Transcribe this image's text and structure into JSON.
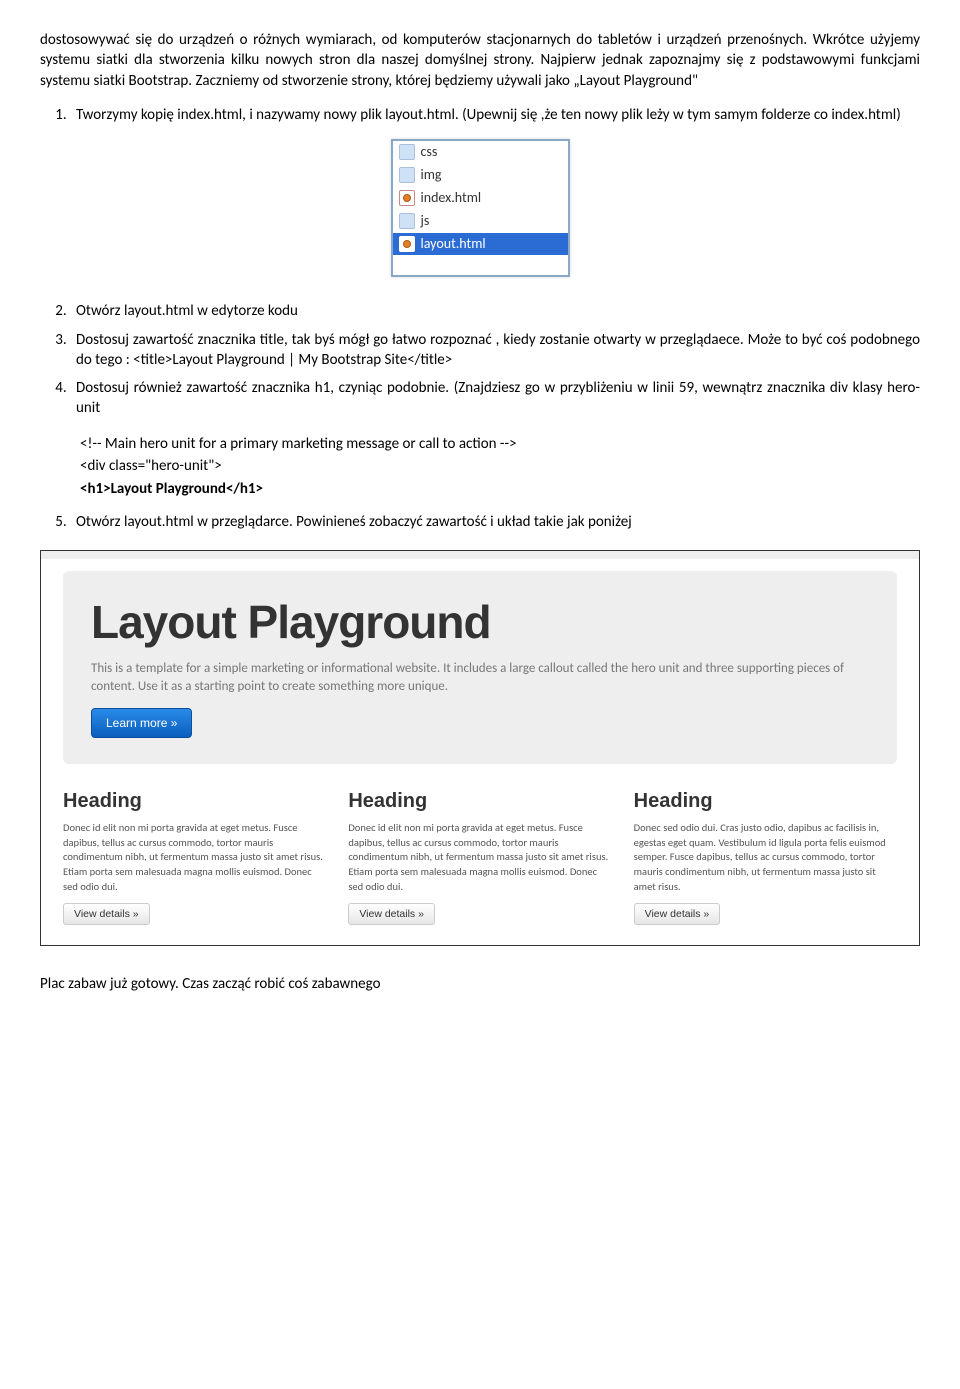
{
  "intro": "dostosowywać się do urządzeń o różnych wymiarach, od komputerów stacjonarnych do tabletów i urządzeń przenośnych. Wkrótce użyjemy systemu siatki dla stworzenia kilku nowych stron dla naszej domyślnej strony. Najpierw jednak zapoznajmy się z podstawowymi funkcjami systemu siatki Bootstrap. Zaczniemy od stworzenie strony, której będziemy używali jako „Layout Playground\"",
  "list1": {
    "item1": "Tworzymy kopię index.html, i nazywamy nowy plik layout.html. (Upewnij się ,że ten nowy plik leży w tym samym folderze co index.html)"
  },
  "files": [
    {
      "name": "css",
      "type": "folder",
      "selected": false
    },
    {
      "name": "img",
      "type": "folder",
      "selected": false
    },
    {
      "name": "index.html",
      "type": "file",
      "selected": false
    },
    {
      "name": "js",
      "type": "folder",
      "selected": false
    },
    {
      "name": "layout.html",
      "type": "file",
      "selected": true
    }
  ],
  "list2": {
    "item2": "Otwórz layout.html w edytorze kodu",
    "item3": "Dostosuj zawartość znacznika title, tak byś mógł go łatwo rozpoznać , kiedy zostanie otwarty w przeglądaece. Może to być coś podobnego do tego : <title>Layout Playground | My Bootstrap Site</title>",
    "item4": "Dostosuj również zawartość znacznika h1, czyniąc podobnie. (Znajdziesz go w przybliżeniu w linii 59, wewnątrz znacznika div klasy hero-unit"
  },
  "code": {
    "l1": "<!-- Main hero unit for a primary marketing message or call to action -->",
    "l2": "<div class=\"hero-unit\">",
    "l3": "<h1>Layout Playground</h1>"
  },
  "list3": {
    "item5": "Otwórz layout.html w przeglądarce. Powinieneś zobaczyć zawartość i układ takie jak poniżej"
  },
  "hero": {
    "title": "Layout Playground",
    "lead": "This is a template for a simple marketing or informational website. It includes a large callout called the hero unit and three supporting pieces of content. Use it as a starting point to create something more unique.",
    "button": "Learn more »"
  },
  "columns": [
    {
      "heading": "Heading",
      "text": "Donec id elit non mi porta gravida at eget metus. Fusce dapibus, tellus ac cursus commodo, tortor mauris condimentum nibh, ut fermentum massa justo sit amet risus. Etiam porta sem malesuada magna mollis euismod. Donec sed odio dui.",
      "button": "View details »"
    },
    {
      "heading": "Heading",
      "text": "Donec id elit non mi porta gravida at eget metus. Fusce dapibus, tellus ac cursus commodo, tortor mauris condimentum nibh, ut fermentum massa justo sit amet risus. Etiam porta sem malesuada magna mollis euismod. Donec sed odio dui.",
      "button": "View details »"
    },
    {
      "heading": "Heading",
      "text": "Donec sed odio dui. Cras justo odio, dapibus ac facilisis in, egestas eget quam. Vestibulum id ligula porta felis euismod semper. Fusce dapibus, tellus ac cursus commodo, tortor mauris condimentum nibh, ut fermentum massa justo sit amet risus.",
      "button": "View details »"
    }
  ],
  "footer": "Plac zabaw już gotowy. Czas zacząć robić coś zabawnego"
}
